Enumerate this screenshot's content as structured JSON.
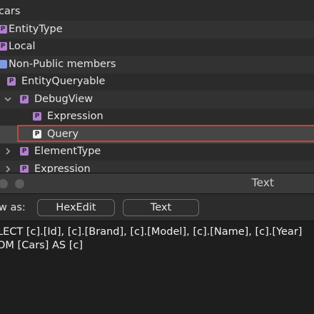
{
  "tree": {
    "items": [
      {
        "label": "cars",
        "badge": ""
      },
      {
        "label": "EntityType",
        "badge": "P"
      },
      {
        "label": "Local",
        "badge": "P"
      },
      {
        "label": "Non-Public members",
        "badge": ""
      },
      {
        "label": "EntityQueryable",
        "badge": "P"
      },
      {
        "label": "DebugView",
        "badge": "P"
      },
      {
        "label": "Expression",
        "badge": "P"
      },
      {
        "label": "Query",
        "badge": "P"
      },
      {
        "label": "ElementType",
        "badge": "P"
      },
      {
        "label": "Expression",
        "badge": "P"
      }
    ]
  },
  "text_window": {
    "title": "Text",
    "view_as_label": "w as:",
    "hexedit_button": "HexEdit",
    "text_button": "Text",
    "content_line1": "LECT [c].[Id], [c].[Brand], [c].[Model], [c].[Name], [c].[Year]",
    "content_line2": "OM [Cars] AS [c]"
  },
  "colors": {
    "selection_outline": "#d6402f",
    "property_badge": "#b27fd0",
    "members_badge": "#7f9be0"
  }
}
